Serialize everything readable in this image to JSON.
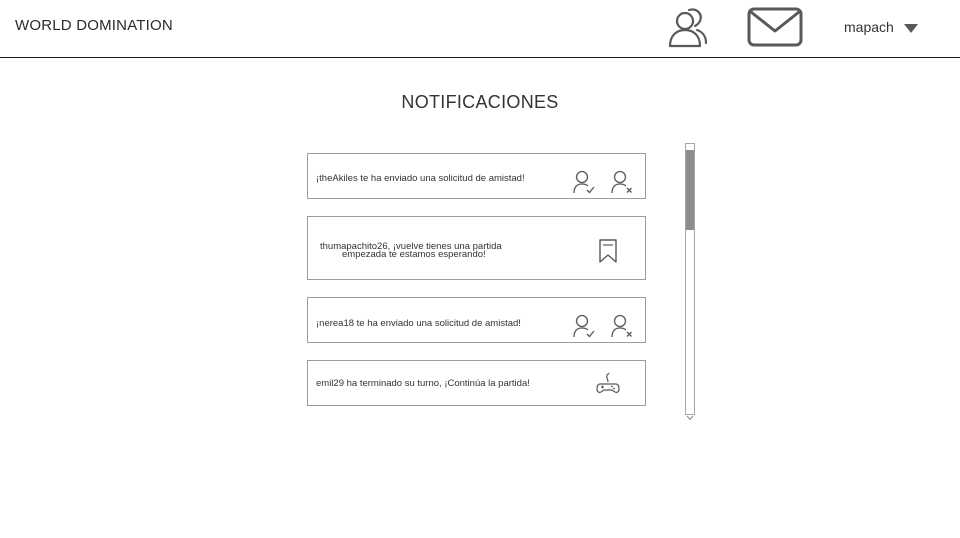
{
  "header": {
    "brand": "WORLD DOMINATION",
    "friends_icon": "users-icon",
    "messages_icon": "envelope-icon",
    "username": "mapach",
    "menu_icon": "caret-down-icon"
  },
  "page": {
    "title": "NOTIFICACIONES"
  },
  "notifications": [
    {
      "type": "friend_request",
      "text": "¡theAkiles te ha enviado una solicitud de amistad!",
      "actions": [
        "accept-friend-icon",
        "reject-friend-icon"
      ]
    },
    {
      "type": "game_reminder",
      "text_line1": "thumapachito26, ¡vuelve tienes una partida",
      "text_line2": "empezada te estamos esperando!",
      "actions": [
        "bookmark-icon"
      ]
    },
    {
      "type": "friend_request",
      "text": "¡nerea18 te ha enviado una solicitud de amistad!",
      "actions": [
        "accept-friend-icon",
        "reject-friend-icon"
      ]
    },
    {
      "type": "turn_finished",
      "text": "emil29 ha terminado su turno, ¡Continúa la partida!",
      "actions": [
        "gamepad-icon"
      ]
    }
  ],
  "scroll": {
    "position_fraction": 0.0,
    "visible_fraction": 0.31
  },
  "colors": {
    "text": "#333333",
    "icon": "#595959",
    "border": "#9c9c9c",
    "scroll_thumb": "#8c8c8c"
  }
}
